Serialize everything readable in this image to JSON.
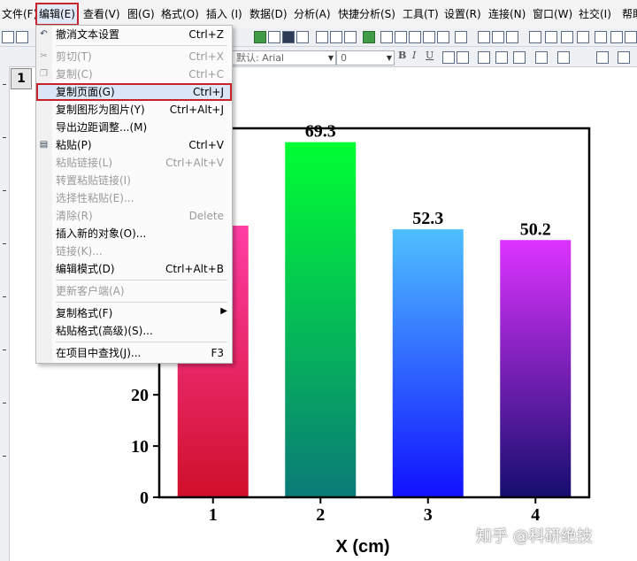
{
  "menubar": {
    "items": [
      "文件(F)",
      "编辑(E)",
      "查看(V)",
      "图(G)",
      "格式(O)",
      "插入 (I)",
      "数据(D)",
      "分析(A)",
      "快捷分析(S)",
      "工具(T)",
      "设置(R)",
      "连接(N)",
      "窗口(W)",
      "社交(I)",
      "帮助"
    ]
  },
  "format_toolbar": {
    "font_value": "默认: Arial",
    "size_value": "0",
    "bold_label": "B",
    "italic_label": "I",
    "underline_label": "U"
  },
  "layer": {
    "label": "1"
  },
  "edit_menu": {
    "items": [
      {
        "label": "撤消文本设置",
        "shortcut": "Ctrl+Z"
      },
      {
        "label": "剪切(T)",
        "shortcut": "Ctrl+X"
      },
      {
        "label": "复制(C)",
        "shortcut": "Ctrl+C"
      },
      {
        "label": "复制页面(G)",
        "shortcut": "Ctrl+J"
      },
      {
        "label": "复制图形为图片(Y)",
        "shortcut": "Ctrl+Alt+J"
      },
      {
        "label": "导出边距调整...(M)",
        "shortcut": ""
      },
      {
        "label": "粘贴(P)",
        "shortcut": "Ctrl+V"
      },
      {
        "label": "粘贴链接(L)",
        "shortcut": "Ctrl+Alt+V"
      },
      {
        "label": "转置粘贴链接(I)",
        "shortcut": ""
      },
      {
        "label": "选择性粘贴(E)...",
        "shortcut": ""
      },
      {
        "label": "清除(R)",
        "shortcut": "Delete"
      },
      {
        "label": "插入新的对象(O)...",
        "shortcut": ""
      },
      {
        "label": "链接(K)...",
        "shortcut": ""
      },
      {
        "label": "编辑模式(D)",
        "shortcut": "Ctrl+Alt+B"
      },
      {
        "label": "更新客户端(A)",
        "shortcut": ""
      },
      {
        "label": "复制格式(F)",
        "shortcut": ""
      },
      {
        "label": "粘贴格式(高级)(S)...",
        "shortcut": ""
      },
      {
        "label": "在项目中查找(J)...",
        "shortcut": "F3"
      }
    ]
  },
  "chart_data": {
    "type": "bar",
    "categories": [
      "1",
      "2",
      "3",
      "4"
    ],
    "values": [
      53.0,
      69.3,
      52.3,
      50.2
    ],
    "data_labels": [
      "",
      "69.3",
      "52.3",
      "50.2"
    ],
    "xlabel": "X (cm)",
    "ylabel": "",
    "ylim": [
      0,
      72
    ],
    "y_ticks": [
      "0",
      "10",
      "20"
    ],
    "grid": false,
    "bar_gradients": [
      {
        "top": "#ff3ea5",
        "bottom": "#d0102a"
      },
      {
        "top": "#00ff33",
        "bottom": "#0a7a78"
      },
      {
        "top": "#4fc0ff",
        "bottom": "#1111ff"
      },
      {
        "top": "#dd33ff",
        "bottom": "#150e6e"
      }
    ]
  },
  "watermark": {
    "text": "知乎 @科研绝技"
  }
}
